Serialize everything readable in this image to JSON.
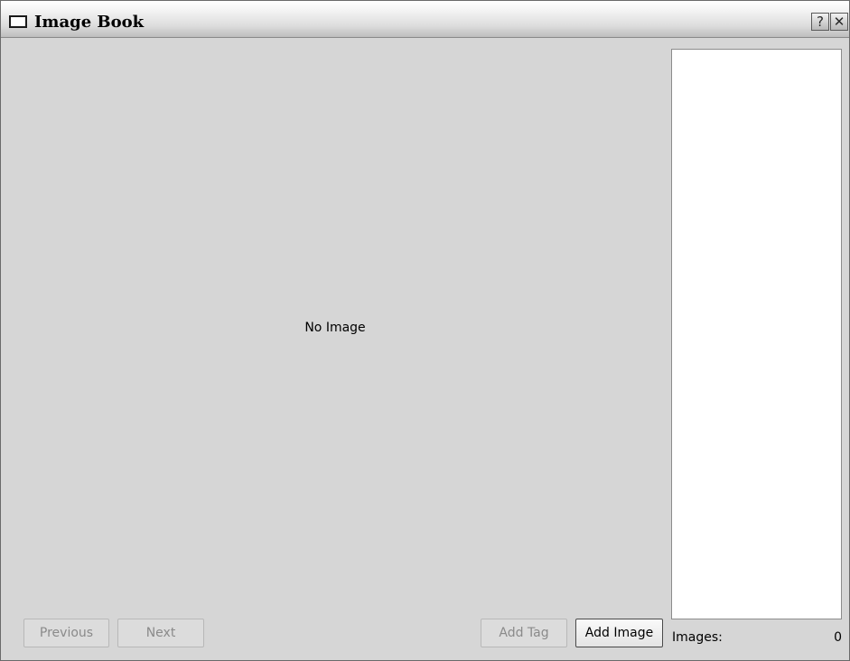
{
  "window": {
    "title": "Image Book",
    "help_glyph": "?",
    "close_glyph": "✕"
  },
  "viewer": {
    "placeholder": "No Image"
  },
  "buttons": {
    "previous": "Previous",
    "next": "Next",
    "add_tag": "Add Tag",
    "add_image": "Add Image"
  },
  "status": {
    "images_label": "Images:",
    "images_count": "0"
  },
  "icons": {
    "window": "window-icon",
    "help": "help-icon",
    "close": "close-icon"
  }
}
